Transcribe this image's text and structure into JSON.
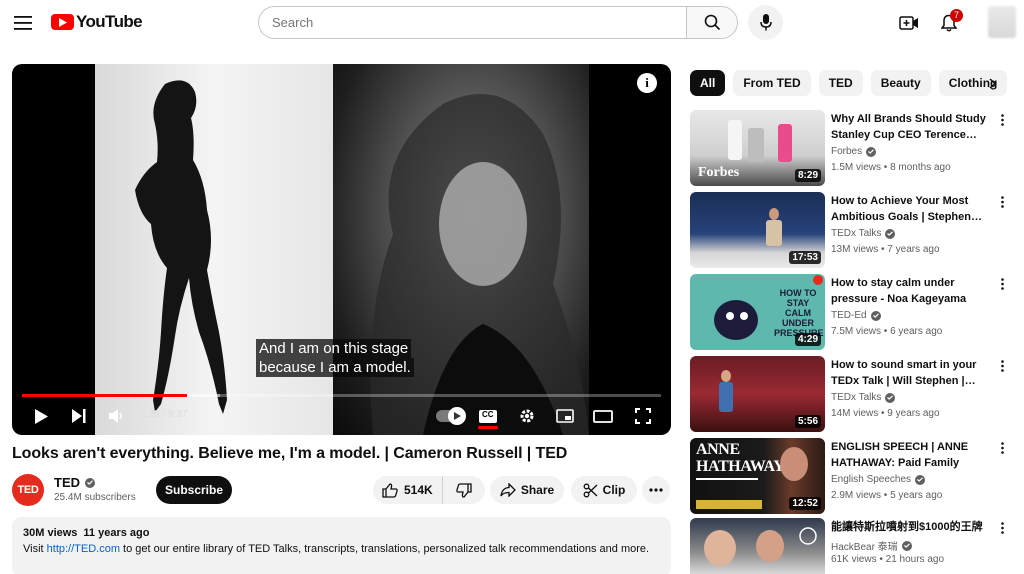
{
  "header": {
    "logo_text": "YouTube",
    "search_placeholder": "Search",
    "notification_count": "7"
  },
  "player": {
    "caption_line1": "And I am on this stage",
    "caption_line2": "because I am a model.",
    "time": "2:29 / 9:37",
    "progress_fraction": 0.258,
    "buffer_fraction": 0.31,
    "info_label": "i",
    "cc_label": "CC"
  },
  "video": {
    "title": "Looks aren't everything. Believe me, I'm a model. | Cameron Russell | TED",
    "channel": "TED",
    "channel_avatar_text": "TED",
    "subscribers": "25.4M subscribers",
    "subscribe_label": "Subscribe",
    "likes": "514K",
    "share_label": "Share",
    "clip_label": "Clip"
  },
  "description": {
    "views": "30M views",
    "age": "11 years ago",
    "text_before": "Visit ",
    "link": "http://TED.com",
    "text_after": " to get our entire library of TED Talks, transcripts, translations, personalized talk recommendations and more."
  },
  "chips": [
    "All",
    "From TED",
    "TED",
    "Beauty",
    "Clothing"
  ],
  "recommendations": [
    {
      "title": "Why All Brands Should Study Stanley Cup CEO Terence…",
      "channel": "Forbes",
      "meta": "1.5M views • 8 months ago",
      "duration": "8:29",
      "thumb_text": "Forbes"
    },
    {
      "title": "How to Achieve Your Most Ambitious Goals | Stephen…",
      "channel": "TEDx Talks",
      "meta": "13M views • 7 years ago",
      "duration": "17:53",
      "thumb_text": ""
    },
    {
      "title": "How to stay calm under pressure - Noa Kageyama and…",
      "channel": "TED-Ed",
      "meta": "7.5M views • 6 years ago",
      "duration": "4:29",
      "thumb_text": "HOW TO STAY CALM UNDER PRESSURE"
    },
    {
      "title": "How to sound smart in your TEDx Talk | Will Stephen |…",
      "channel": "TEDx Talks",
      "meta": "14M views • 9 years ago",
      "duration": "5:56",
      "thumb_text": ""
    },
    {
      "title": "ENGLISH SPEECH | ANNE HATHAWAY: Paid Family Leav…",
      "channel": "English Speeches",
      "meta": "2.9M views • 5 years ago",
      "duration": "12:52",
      "thumb_text": "ANNE HATHAWAY"
    },
    {
      "title": "能讓特斯拉噴射到$1000的王牌",
      "channel": "HackBear 泰瑞",
      "meta": "61K views • 21 hours ago",
      "duration": "",
      "thumb_text": ""
    }
  ],
  "colors": {
    "brand_red": "#ff0000",
    "ted_red": "#e62b1e",
    "link_blue": "#065fd4"
  }
}
